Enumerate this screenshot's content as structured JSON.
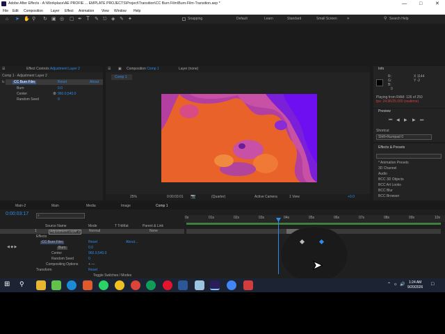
{
  "window_title": "Adobe After Effects - A:\\Workplace\\AE PROFIE ... EMPLATE PROJECTS\\Project\\Transition\\CC Burn Film\\Burn-Film-Transition.aep *",
  "menu": [
    "File",
    "Edit",
    "Composition",
    "Layer",
    "Effect",
    "Animation",
    "View",
    "Window",
    "Help"
  ],
  "toolbar": {
    "snapping": "Snapping",
    "workspaces": [
      "Default",
      "Learn",
      "Standard",
      "Small Screen"
    ],
    "search_placeholder": "Search Help"
  },
  "effect_controls": {
    "tab": "Effect Controls Adjustment Layer 2",
    "tab_prefix": "Effect Controls",
    "tab_name": "Adjustment Layer 2",
    "layer_path": "Comp 1 · Adjustment Layer 2",
    "effect_name": "CC Burn Film",
    "reset": "Reset",
    "about": "About",
    "props": [
      {
        "name": "Burn",
        "value": "0.0"
      },
      {
        "name": "Center",
        "value": "960.0,540.0"
      },
      {
        "name": "Random Seed",
        "value": "0"
      }
    ]
  },
  "composition": {
    "tab": "Composition Comp 1",
    "tab_prefix": "Composition",
    "tab_name": "Comp 1",
    "layer_tab": "Layer (none)",
    "comp_label": "Comp 1",
    "zoom": "25%",
    "timecode": "0:00:03:01",
    "resolution": "(Quarter)",
    "camera": "Active Camera",
    "views": "1 View",
    "exposure": "+0.0"
  },
  "info": {
    "title": "Info",
    "x": "X  1144",
    "y": "Y   -2",
    "r": "R:",
    "g": "G:",
    "b": "B:",
    "a": "A:  0",
    "a_val": "0",
    "playing": "Playing from RAM: 126 of 250",
    "fps": "fps: 24.96/25.000 (realtime)"
  },
  "preview": {
    "title": "Preview",
    "shortcut_label": "Shortcut",
    "shortcut_value": "Shift+Numpad 0"
  },
  "effects_presets": {
    "title": "Effects & Presets",
    "items": [
      "* Animation Presets",
      "3D Channel",
      "Audio",
      "BCC 3D Objects",
      "BCC Art Looks",
      "BCC Blur",
      "BCC Browser"
    ]
  },
  "timeline": {
    "tabs": [
      "Main-2",
      "Main",
      "Media",
      "Image",
      "Comp 1"
    ],
    "timecode": "0:00:03:17",
    "search_placeholder": "⌕",
    "columns": {
      "source": "Source Name",
      "mode": "Mode",
      "trkmat": "T TrkMat",
      "parent": "Parent & Link"
    },
    "layer_num": "1",
    "layer_name": "Adjustment Layer 2",
    "layer_mode": "Normal",
    "layer_parent": "None",
    "effects_label": "Effects",
    "effect_name": "CC Burn Film",
    "reset": "Reset",
    "about": "About...",
    "props": [
      {
        "name": "Burn",
        "value": "0.0"
      },
      {
        "name": "Center",
        "value": "960.0,540.0"
      },
      {
        "name": "Random Seed",
        "value": "0"
      },
      {
        "name": "Compositing Options",
        "value": "+ —"
      }
    ],
    "transform": "Transform",
    "transform_reset": "Reset",
    "footer": "Toggle Switches / Modes",
    "ruler": [
      "0s",
      "01s",
      "02s",
      "03s",
      "04s",
      "05s",
      "06s",
      "07s",
      "08s",
      "09s",
      "10s"
    ]
  },
  "taskbar": {
    "time": "1:24 AM",
    "date": "9/20/2026"
  }
}
